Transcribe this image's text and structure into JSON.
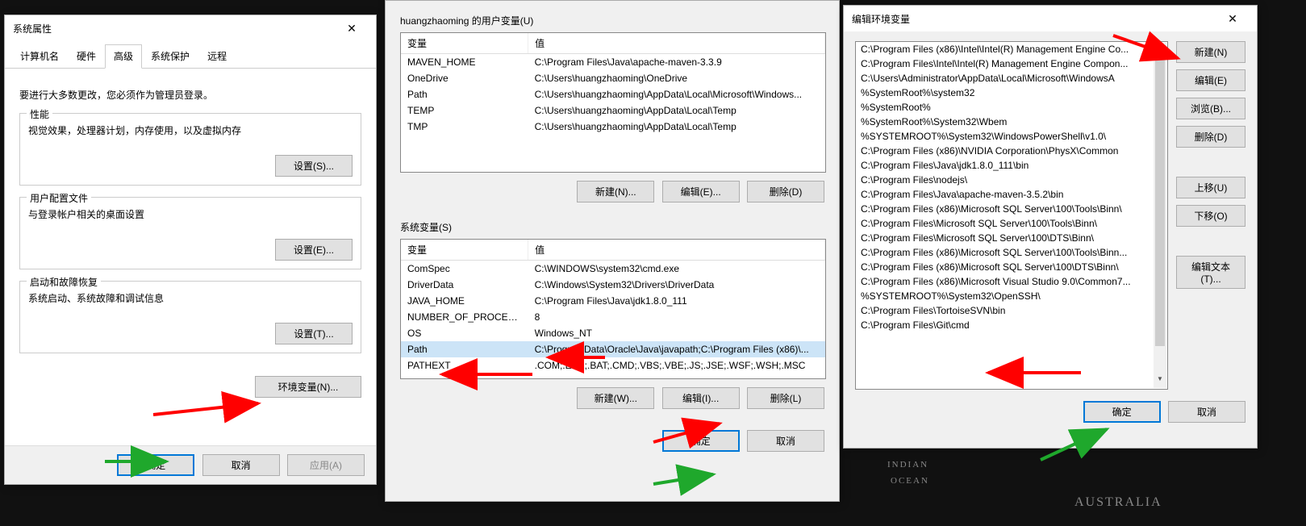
{
  "dlg1": {
    "title": "系统属性",
    "tabs": [
      "计算机名",
      "硬件",
      "高级",
      "系统保护",
      "远程"
    ],
    "active_tab": 2,
    "intro": "要进行大多数更改，您必须作为管理员登录。",
    "perf": {
      "legend": "性能",
      "desc": "视觉效果，处理器计划，内存使用，以及虚拟内存",
      "btn": "设置(S)..."
    },
    "profile": {
      "legend": "用户配置文件",
      "desc": "与登录帐户相关的桌面设置",
      "btn": "设置(E)..."
    },
    "startup": {
      "legend": "启动和故障恢复",
      "desc": "系统启动、系统故障和调试信息",
      "btn": "设置(T)..."
    },
    "env_btn": "环境变量(N)...",
    "ok": "确定",
    "cancel": "取消",
    "apply": "应用(A)"
  },
  "dlg2": {
    "user_label": "huangzhaoming 的用户变量(U)",
    "col_var": "变量",
    "col_val": "值",
    "user_vars": [
      {
        "k": "MAVEN_HOME",
        "v": "C:\\Program Files\\Java\\apache-maven-3.3.9"
      },
      {
        "k": "OneDrive",
        "v": "C:\\Users\\huangzhaoming\\OneDrive"
      },
      {
        "k": "Path",
        "v": "C:\\Users\\huangzhaoming\\AppData\\Local\\Microsoft\\Windows..."
      },
      {
        "k": "TEMP",
        "v": "C:\\Users\\huangzhaoming\\AppData\\Local\\Temp"
      },
      {
        "k": "TMP",
        "v": "C:\\Users\\huangzhaoming\\AppData\\Local\\Temp"
      }
    ],
    "sys_label": "系统变量(S)",
    "sys_vars": [
      {
        "k": "ComSpec",
        "v": "C:\\WINDOWS\\system32\\cmd.exe"
      },
      {
        "k": "DriverData",
        "v": "C:\\Windows\\System32\\Drivers\\DriverData"
      },
      {
        "k": "JAVA_HOME",
        "v": "C:\\Program Files\\Java\\jdk1.8.0_111"
      },
      {
        "k": "NUMBER_OF_PROCESSORS",
        "v": "8"
      },
      {
        "k": "OS",
        "v": "Windows_NT"
      },
      {
        "k": "Path",
        "v": "C:\\ProgramData\\Oracle\\Java\\javapath;C:\\Program Files (x86)\\...",
        "sel": true
      },
      {
        "k": "PATHEXT",
        "v": ".COM;.EXE;.BAT;.CMD;.VBS;.VBE;.JS;.JSE;.WSF;.WSH;.MSC"
      }
    ],
    "new_btn": "新建(N)...",
    "edit_btn": "编辑(E)...",
    "del_btn": "删除(D)",
    "new_btn2": "新建(W)...",
    "edit_btn2": "编辑(I)...",
    "del_btn2": "删除(L)",
    "ok": "确定",
    "cancel": "取消"
  },
  "dlg3": {
    "title": "编辑环境变量",
    "items": [
      "C:\\Program Files (x86)\\Intel\\Intel(R) Management Engine Co...",
      "C:\\Program Files\\Intel\\Intel(R) Management Engine Compon...",
      "C:\\Users\\Administrator\\AppData\\Local\\Microsoft\\WindowsA",
      "%SystemRoot%\\system32",
      "%SystemRoot%",
      "%SystemRoot%\\System32\\Wbem",
      "%SYSTEMROOT%\\System32\\WindowsPowerShell\\v1.0\\",
      "C:\\Program Files (x86)\\NVIDIA Corporation\\PhysX\\Common",
      "C:\\Program Files\\Java\\jdk1.8.0_111\\bin",
      "C:\\Program Files\\nodejs\\",
      "C:\\Program Files\\Java\\apache-maven-3.5.2\\bin",
      "C:\\Program Files (x86)\\Microsoft SQL Server\\100\\Tools\\Binn\\",
      "C:\\Program Files\\Microsoft SQL Server\\100\\Tools\\Binn\\",
      "C:\\Program Files\\Microsoft SQL Server\\100\\DTS\\Binn\\",
      "C:\\Program Files (x86)\\Microsoft SQL Server\\100\\Tools\\Binn...",
      "C:\\Program Files (x86)\\Microsoft SQL Server\\100\\DTS\\Binn\\",
      "C:\\Program Files (x86)\\Microsoft Visual Studio 9.0\\Common7...",
      "%SYSTEMROOT%\\System32\\OpenSSH\\",
      "C:\\Program Files\\TortoiseSVN\\bin",
      "C:\\Program Files\\Git\\cmd"
    ],
    "btn_new": "新建(N)",
    "btn_edit": "编辑(E)",
    "btn_browse": "浏览(B)...",
    "btn_delete": "删除(D)",
    "btn_up": "上移(U)",
    "btn_down": "下移(O)",
    "btn_edittext": "编辑文本(T)...",
    "ok": "确定",
    "cancel": "取消"
  },
  "map": {
    "indian": "INDIAN",
    "ocean": "OCEAN",
    "australia": "AUSTRALIA"
  }
}
